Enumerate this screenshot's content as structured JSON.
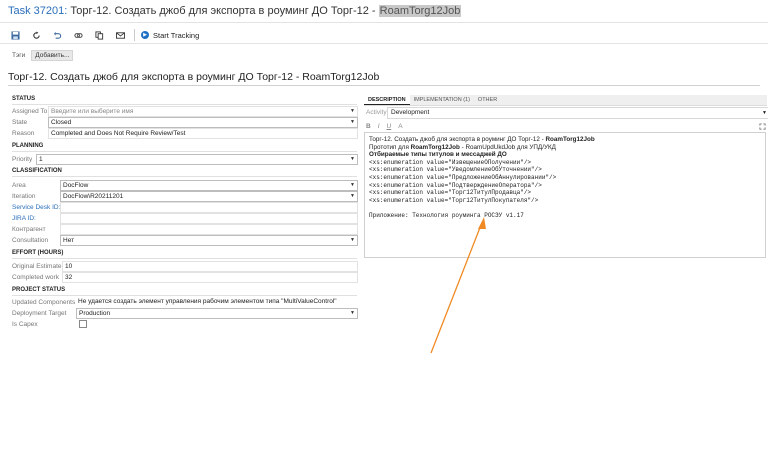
{
  "window": {
    "task_id": "Task 37201:",
    "title_main": "Торг-12. Создать джоб для экспорта в роуминг ДО Торг-12 - ",
    "title_highlight": "RoamTorg12Job"
  },
  "toolbar": {
    "icons": [
      "save-icon",
      "refresh-icon",
      "undo-icon",
      "link-icon",
      "copy-icon",
      "email-icon"
    ],
    "start_tracking": "Start Tracking"
  },
  "tags": {
    "label": "Тэги",
    "add_button": "Добавить..."
  },
  "work_item_title": "Торг-12. Создать джоб для экспорта в роуминг ДО Торг-12 - RoamTorg12Job",
  "status": {
    "heading": "STATUS",
    "assigned_to_label": "Assigned To",
    "assigned_to_placeholder": "Введите или выберите имя",
    "state_label": "State",
    "state_value": "Closed",
    "reason_label": "Reason",
    "reason_value": "Completed and Does Not Require Review/Test"
  },
  "planning": {
    "heading": "PLANNING",
    "priority_label": "Priority",
    "priority_value": "1"
  },
  "classification": {
    "heading": "CLASSIFICATION",
    "area_label": "Area",
    "area_value": "DocFlow",
    "iteration_label": "Iteration",
    "iteration_value": "DocFlow\\R20211201",
    "service_desk_label": "Service Desk ID:",
    "jira_label": "JIRA ID:",
    "counterparty_label": "Контрагент",
    "consultation_label": "Consultation",
    "consultation_value": "Нет"
  },
  "effort": {
    "heading": "EFFORT (HOURS)",
    "original_label": "Original Estimate",
    "original_value": "10",
    "completed_label": "Completed work",
    "completed_value": "32"
  },
  "project_status": {
    "heading": "PROJECT STATUS",
    "updated_components_label": "Updated Components",
    "updated_components_value": "Не удается создать элемент управления рабочим элементом типа \"MultiValueControl\"",
    "deployment_label": "Deployment Target",
    "deployment_value": "Production",
    "capex_label": "Is Capex"
  },
  "tabs": {
    "description": "DESCRIPTION",
    "implementation": "IMPLEMENTATION (1)",
    "other": "OTHER"
  },
  "activity": {
    "label": "Activity",
    "value": "Development"
  },
  "rte_tools": [
    "B",
    "I",
    "U",
    "A"
  ],
  "description": {
    "line1_text": "Торг-12. Создать джоб для экспорта в роуминг ДО Торг-12 - ",
    "line1_bold": "RoamTorg12Job",
    "line2_a": "Прототип для ",
    "line2_bold": "RoamTorg12Job",
    "line2_b": " - RoamUpdUkdJob для УПД/УКД",
    "line3": "Отбираемые типы титулов и месcаджей ДО",
    "enum_lines": [
      "<xs:enumeration value=\"ИзвещениеОПолучении\"/>",
      "<xs:enumeration value=\"УведомлениеОбУточнении\"/>",
      "<xs:enumeration value=\"ПредложениеОбАннулировании\"/>",
      "<xs:enumeration value=\"ПодтверждениеОператора\"/>",
      "<xs:enumeration value=\"Торг12ТитулПродавца\"/>",
      "<xs:enumeration value=\"Торг12ТитулПокупателя\"/>"
    ],
    "appendix": "Приложение: Технология роуминга РОСЭУ v1.17"
  },
  "colors": {
    "accent": "#2a6ebb",
    "annotation_arrow": "#f08a24"
  }
}
